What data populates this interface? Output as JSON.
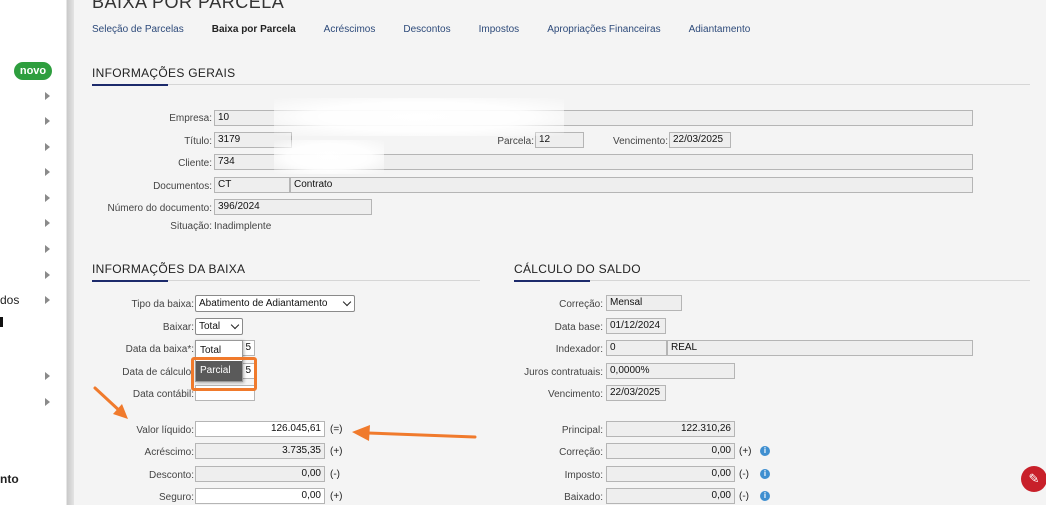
{
  "sidebar": {
    "novo_badge": "novo",
    "partial_items": [
      "dos",
      "nto"
    ]
  },
  "page": {
    "title": "BAIXA POR PARCELA",
    "tabs": [
      "Seleção de Parcelas",
      "Baixa por Parcela",
      "Acréscimos",
      "Descontos",
      "Impostos",
      "Apropriações Financeiras",
      "Adiantamento"
    ],
    "active_tab": "Baixa por Parcela"
  },
  "gerais": {
    "title": "INFORMAÇÕES GERAIS",
    "empresa_label": "Empresa:",
    "empresa": "10",
    "titulo_label": "Título:",
    "titulo": "3179",
    "parcela_label": "Parcela:",
    "parcela": "12",
    "vencimento_label": "Vencimento:",
    "vencimento": "22/03/2025",
    "cliente_label": "Cliente:",
    "cliente": "734",
    "documentos_label": "Documentos:",
    "doc_tipo": "CT",
    "doc_desc": "Contrato",
    "numero_doc_label": "Número do documento:",
    "numero_doc": "396/2024",
    "situacao_label": "Situação:",
    "situacao": "Inadimplente"
  },
  "baixa": {
    "title": "INFORMAÇÕES DA BAIXA",
    "tipo_label": "Tipo da baixa:",
    "tipo": "Abatimento de Adiantamento",
    "baixar_label": "Baixar:",
    "baixar": "Total",
    "data_baixa_label": "Data da baixa*:",
    "data_baixa_suffix": "5",
    "data_calculo_label": "Data de cálculo:",
    "data_calculo_suffix": "5",
    "data_contabil_label": "Data contábil:",
    "dropdown_options": [
      "Total",
      "Parcial"
    ],
    "dropdown_selected": "Parcial",
    "valor_liquido_label": "Valor líquido:",
    "valor_liquido": "126.045,61",
    "valor_liquido_sym": "(=)",
    "acrescimo_label": "Acréscimo:",
    "acrescimo": "3.735,35",
    "acrescimo_sym": "(+)",
    "desconto_label": "Desconto:",
    "desconto": "0,00",
    "desconto_sym": "(-)",
    "seguro_label": "Seguro:",
    "seguro": "0,00",
    "seguro_sym": "(+)"
  },
  "saldo": {
    "title": "CÁLCULO DO SALDO",
    "correcao_label": "Correção:",
    "correcao": "Mensal",
    "data_base_label": "Data base:",
    "data_base": "01/12/2024",
    "indexador_label": "Indexador:",
    "indexador_code": "0",
    "indexador_name": "REAL",
    "juros_label": "Juros contratuais:",
    "juros": "0,0000%",
    "vencimento_label": "Vencimento:",
    "vencimento": "22/03/2025",
    "principal_label": "Principal:",
    "principal": "122.310,26",
    "correcao_val_label": "Correção:",
    "correcao_val": "0,00",
    "correcao_sym": "(+)",
    "imposto_label": "Imposto:",
    "imposto": "0,00",
    "imposto_sym": "(-)",
    "baixado_label": "Baixado:",
    "baixado": "0,00",
    "baixado_sym": "(-)"
  },
  "colors": {
    "accent": "#1c2a6b",
    "annotation": "#f07a2c",
    "novo": "#2e9e3e",
    "fab": "#c8202a",
    "info": "#3f8fd0"
  }
}
